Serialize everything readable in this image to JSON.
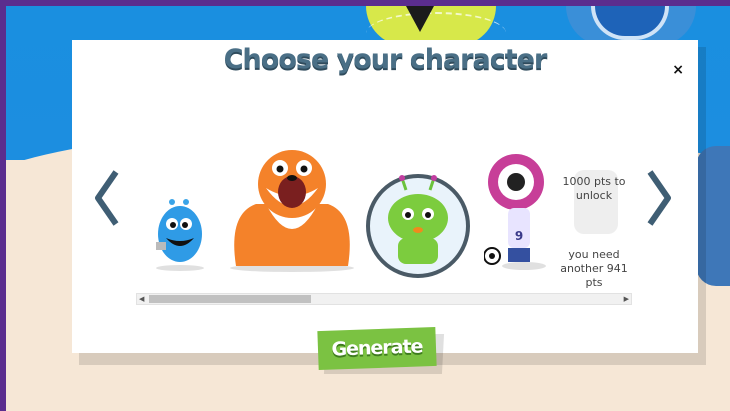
{
  "dialog": {
    "title": "Choose your character",
    "close_label": "×"
  },
  "characters": [
    {
      "name": "blue-monster"
    },
    {
      "name": "orange-tiger"
    },
    {
      "name": "green-alien"
    },
    {
      "name": "purple-eyeball"
    }
  ],
  "locked": {
    "cost_text": "1000 pts to unlock",
    "need_text": "you need another 941 pts"
  },
  "actions": {
    "generate_label": "Generate"
  },
  "colors": {
    "accent_green": "#7bc242",
    "title_blue": "#4a6f86",
    "arrow_blue": "#3f5e74"
  }
}
